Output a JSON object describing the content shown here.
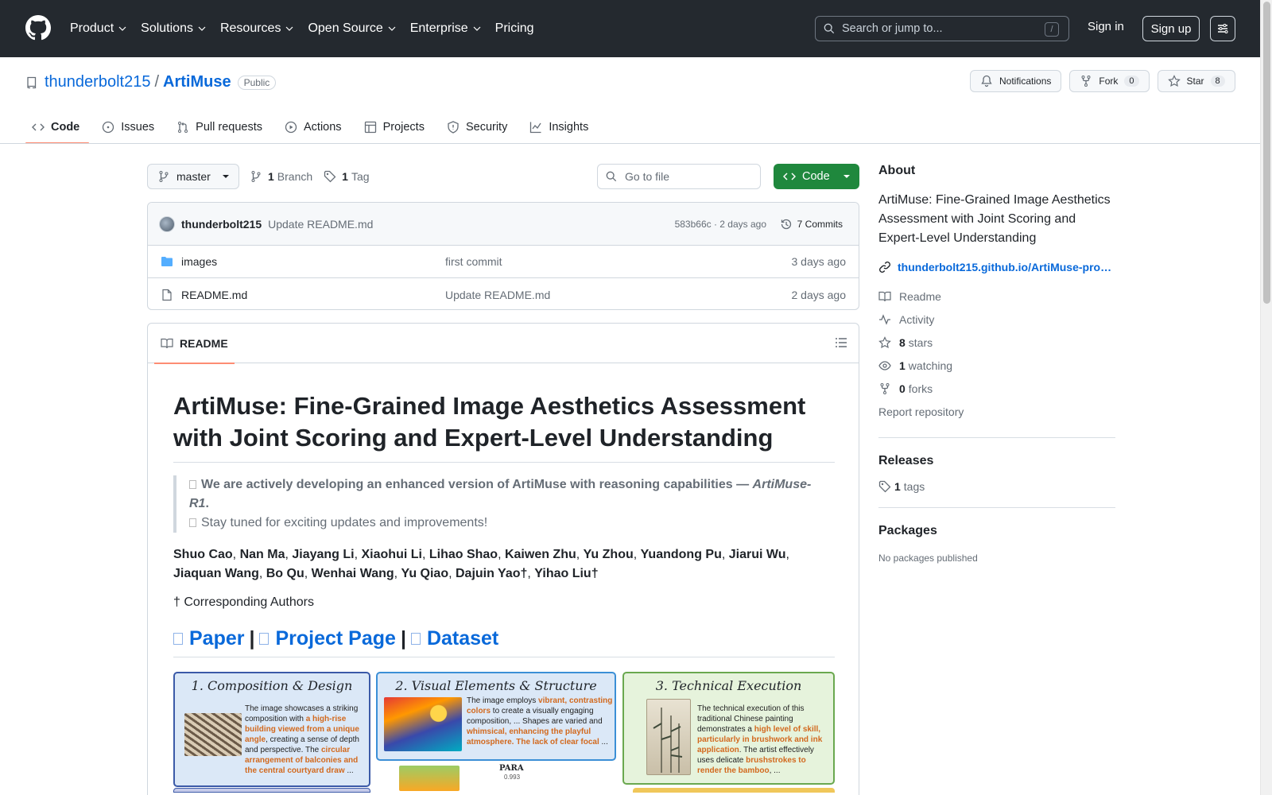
{
  "header": {
    "nav": [
      "Product",
      "Solutions",
      "Resources",
      "Open Source",
      "Enterprise",
      "Pricing"
    ],
    "search_placeholder": "Search or jump to...",
    "search_key": "/",
    "sign_in": "Sign in",
    "sign_up": "Sign up"
  },
  "repo": {
    "owner": "thunderbolt215",
    "separator": "/",
    "name": "ArtiMuse",
    "visibility": "Public",
    "notifications": "Notifications",
    "fork_label": "Fork",
    "fork_count": "0",
    "star_label": "Star",
    "star_count": "8"
  },
  "tabs": [
    {
      "label": "Code",
      "icon": "code-icon",
      "active": true
    },
    {
      "label": "Issues",
      "icon": "issue-icon"
    },
    {
      "label": "Pull requests",
      "icon": "pull-request-icon"
    },
    {
      "label": "Actions",
      "icon": "play-icon"
    },
    {
      "label": "Projects",
      "icon": "table-icon"
    },
    {
      "label": "Security",
      "icon": "shield-icon"
    },
    {
      "label": "Insights",
      "icon": "graph-icon"
    }
  ],
  "branch": {
    "name": "master",
    "branch_count": "1",
    "branch_label": "Branch",
    "tag_count": "1",
    "tag_label": "Tag",
    "goto_placeholder": "Go to file",
    "code_button": "Code"
  },
  "commit": {
    "author": "thunderbolt215",
    "message": "Update README.md",
    "meta": "583b66c · 2 days ago",
    "commits": "7 Commits"
  },
  "files": [
    {
      "name": "images",
      "type": "folder",
      "message": "first commit",
      "age": "3 days ago"
    },
    {
      "name": "README.md",
      "type": "file",
      "message": "Update README.md",
      "age": "2 days ago"
    }
  ],
  "readme": {
    "tab": "README",
    "title": "ArtiMuse: Fine-Grained Image Aesthetics Assessment with Joint Scoring and Expert-Level Understanding",
    "quote_line1_bold": "We are actively developing an enhanced version of ArtiMuse with reasoning capabilities — ",
    "quote_line1_italic": "ArtiMuse-R1",
    "quote_line1_end": ".",
    "quote_line2": "Stay tuned for exciting updates and improvements!",
    "authors": [
      "Shuo Cao",
      "Nan Ma",
      "Jiayang Li",
      "Xiaohui Li",
      "Lihao Shao",
      "Kaiwen Zhu",
      "Yu Zhou",
      "Yuandong Pu",
      "Jiarui Wu",
      "Jiaquan Wang",
      "Bo Qu",
      "Wenhai Wang",
      "Yu Qiao",
      "Dajuin Yao†",
      "Yihao Liu†"
    ],
    "corresponding": "† Corresponding Authors",
    "links": {
      "paper": "Paper",
      "project": "Project Page",
      "dataset": "Dataset",
      "sep": "|"
    },
    "figure": {
      "p1_title": "1. Composition & Design",
      "p1_text": [
        {
          "t": "The image showcases a striking composition with ",
          "h": false
        },
        {
          "t": "a high-rise building viewed from a unique angle",
          "h": true
        },
        {
          "t": ", creating a sense of depth and perspective. The ",
          "h": false
        },
        {
          "t": "circular arrangement of balconies and the central courtyard draw",
          "h": true
        },
        {
          "t": " ...",
          "h": false
        }
      ],
      "p2_title": "2. Visual Elements & Structure",
      "p2_text": [
        {
          "t": "The image employs ",
          "h": false
        },
        {
          "t": "vibrant, contrasting colors",
          "h": true
        },
        {
          "t": " to create a visually engaging composition, ... Shapes are varied and ",
          "h": false
        },
        {
          "t": "whimsical, enhancing the playful atmosphere. The lack of clear focal",
          "h": true
        },
        {
          "t": " ...",
          "h": false
        }
      ],
      "p3_title": "3. Technical Execution",
      "p3_text": [
        {
          "t": "The technical execution of this traditional Chinese painting demonstrates a ",
          "h": false
        },
        {
          "t": "high level of skill, particularly in brushwork and ink application",
          "h": true
        },
        {
          "t": ". The artist effectively uses delicate ",
          "h": false
        },
        {
          "t": "brushstrokes to render the bamboo",
          "h": true
        },
        {
          "t": ", ...",
          "h": false
        }
      ],
      "para_label": "PARA",
      "para_value": "0.993"
    }
  },
  "sidebar": {
    "about": "About",
    "description": "ArtiMuse: Fine-Grained Image Aesthetics Assessment with Joint Scoring and Expert-Level Understanding",
    "website": "thunderbolt215.github.io/ArtiMuse-pro…",
    "readme": "Readme",
    "activity": "Activity",
    "stars_count": "8",
    "stars_label": "stars",
    "watching_count": "1",
    "watching_label": "watching",
    "forks_count": "0",
    "forks_label": "forks",
    "report": "Report repository",
    "releases": "Releases",
    "tags_count": "1",
    "tags_label": "tags",
    "packages": "Packages",
    "no_packages": "No packages published"
  },
  "colors": {
    "header_bg": "#24292f",
    "link": "#0969da",
    "primary_button": "#1f883d",
    "tab_underline": "#fd8c73",
    "highlight_text": "#d2691e"
  }
}
